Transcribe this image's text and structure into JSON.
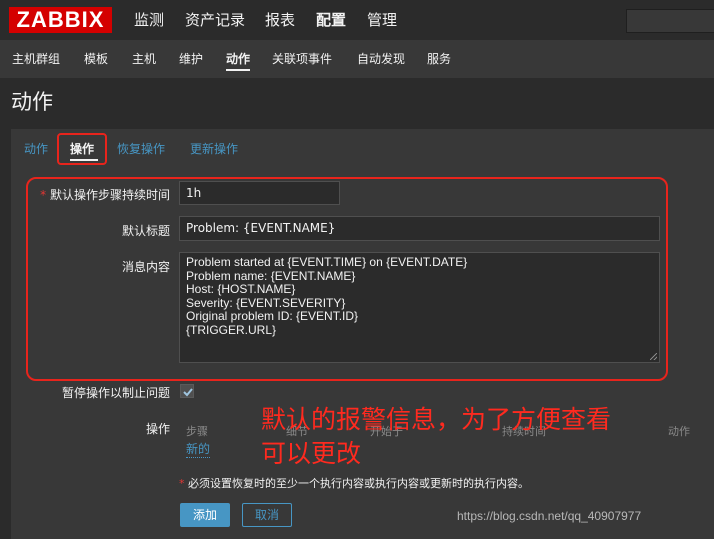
{
  "topnav": {
    "logo": "ZABBIX",
    "items": [
      "监测",
      "资产记录",
      "报表",
      "配置",
      "管理"
    ],
    "active": "配置"
  },
  "subnav": {
    "items": [
      "主机群组",
      "模板",
      "主机",
      "维护",
      "动作",
      "关联项事件",
      "自动发现",
      "服务"
    ],
    "active": "动作"
  },
  "page": {
    "title": "动作"
  },
  "tabs": [
    "动作",
    "操作",
    "恢复操作",
    "更新操作"
  ],
  "active_tab": "操作",
  "form": {
    "default_step_duration": {
      "required_mark": "*",
      "label": "默认操作步骤持续时间",
      "value": "1h"
    },
    "default_subject": {
      "label": "默认标题",
      "value": "Problem: {EVENT.NAME}"
    },
    "default_message": {
      "label": "消息内容",
      "lines": [
        "Problem started at {EVENT.TIME} on {EVENT.DATE}",
        "Problem name: {EVENT.NAME}",
        "Host: {HOST.NAME}",
        "Severity: {EVENT.SEVERITY}",
        "",
        "Original problem ID: {EVENT.ID}",
        "{TRIGGER.URL}"
      ]
    },
    "pause_suppressed": {
      "label": "暂停操作以制止问题",
      "checked": true
    },
    "operations": {
      "label": "操作",
      "columns": [
        "步骤",
        "细节",
        "开始于",
        "持续时间",
        "动作"
      ],
      "new_link": "新的"
    },
    "note": {
      "required_mark": "*",
      "text": "必须设置恢复时的至少一个执行内容或执行内容或更新时的执行内容。"
    },
    "buttons": {
      "add": "添加",
      "cancel": "取消"
    }
  },
  "annotation": {
    "line1": "默认的报警信息，为了方便查看",
    "line2": "可以更改"
  },
  "watermark": "https://blog.csdn.net/qq_40907977",
  "colors": {
    "accent": "#4796c4",
    "highlight": "#e8241c",
    "logo": "#d40000",
    "annotation": "#ff2a1f"
  }
}
